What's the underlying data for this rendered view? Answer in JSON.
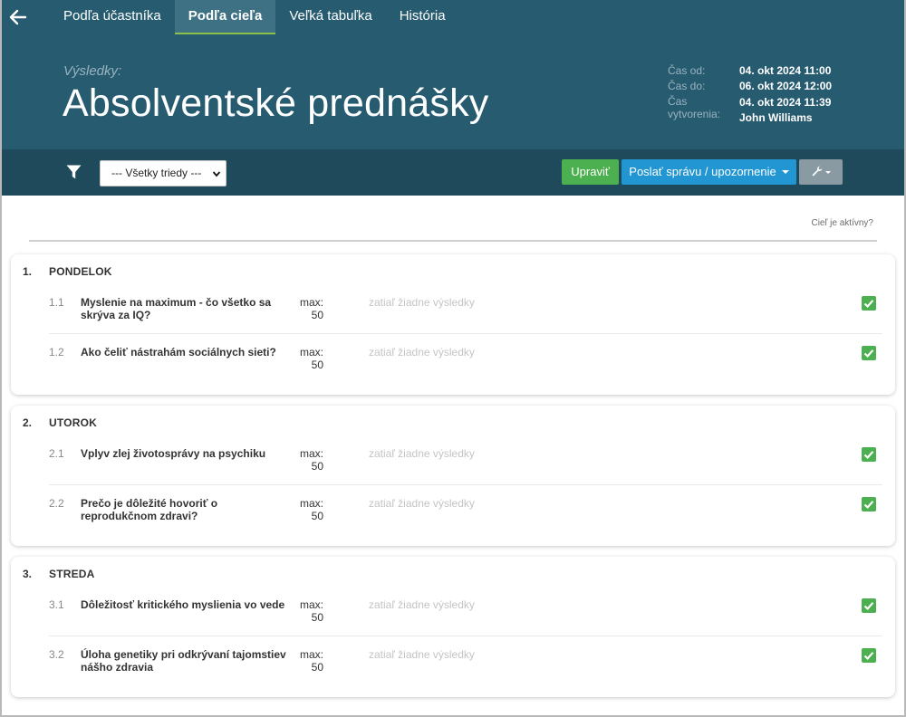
{
  "nav": {
    "back_icon": "arrow-left-icon",
    "tabs": [
      {
        "label": "Podľa účastníka",
        "active": false
      },
      {
        "label": "Podľa cieľa",
        "active": true
      },
      {
        "label": "Veľká tabuľka",
        "active": false
      },
      {
        "label": "História",
        "active": false
      }
    ]
  },
  "header": {
    "results_label": "Výsledky:",
    "title": "Absolventské prednášky",
    "meta": {
      "from_label": "Čas od:",
      "from_value": "04. okt 2024 11:00",
      "to_label": "Čas do:",
      "to_value": "06. okt 2024 12:00",
      "created_label": "Čas vytvorenia:",
      "created_value": "04. okt 2024 11:39",
      "author": "John Williams"
    }
  },
  "toolbar": {
    "filter_icon": "filter-icon",
    "class_select": "--- Všetky triedy ---",
    "edit_label": "Upraviť",
    "send_label": "Poslať správu / upozornenie",
    "tools_icon": "wrench-icon"
  },
  "active_link": "Cieľ je aktívny?",
  "colors": {
    "header_bg": "#265b70",
    "toolbar_bg": "#1e4a5c",
    "active_tab_underline": "#8bc34a",
    "edit_button": "#4caf50",
    "send_button": "#2196d3",
    "check": "#4caf50"
  },
  "sections": [
    {
      "num": "1.",
      "title": "PONDELOK",
      "items": [
        {
          "num": "1.1",
          "name": "Myslenie na maximum - čo všetko sa skrýva za IQ?",
          "max_label": "max:",
          "max_value": "50",
          "status": "zatiaľ žiadne výsledky",
          "checked": true
        },
        {
          "num": "1.2",
          "name": "Ako čeliť nástrahám sociálnych sieti?",
          "max_label": "max:",
          "max_value": "50",
          "status": "zatiaľ žiadne výsledky",
          "checked": true
        }
      ]
    },
    {
      "num": "2.",
      "title": "UTOROK",
      "items": [
        {
          "num": "2.1",
          "name": "Vplyv zlej životosprávy na psychiku",
          "max_label": "max:",
          "max_value": "50",
          "status": "zatiaľ žiadne výsledky",
          "checked": true
        },
        {
          "num": "2.2",
          "name": "Prečo je dôležité hovoriť o reprodukčnom zdravi?",
          "max_label": "max:",
          "max_value": "50",
          "status": "zatiaľ žiadne výsledky",
          "checked": true
        }
      ]
    },
    {
      "num": "3.",
      "title": "STREDA",
      "items": [
        {
          "num": "3.1",
          "name": "Dôležitosť kritického myslienia vo vede",
          "max_label": "max:",
          "max_value": "50",
          "status": "zatiaľ žiadne výsledky",
          "checked": true
        },
        {
          "num": "3.2",
          "name": "Úloha genetiky pri odkrývaní tajomstiev nášho zdravia",
          "max_label": "max:",
          "max_value": "50",
          "status": "zatiaľ žiadne výsledky",
          "checked": true
        }
      ]
    }
  ]
}
